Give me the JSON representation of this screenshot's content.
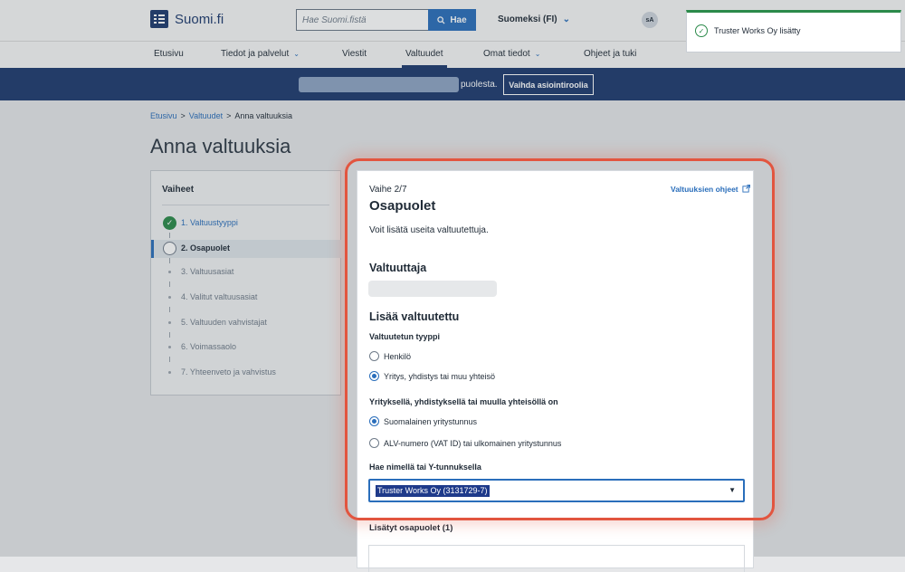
{
  "header": {
    "logo_text": "Suomi.fi",
    "search_placeholder": "Hae Suomi.fistä",
    "search_button": "Hae",
    "language": "Suomeksi (FI)",
    "user_initials": "sA"
  },
  "nav": {
    "items": [
      {
        "label": "Etusivu"
      },
      {
        "label": "Tiedot ja palvelut"
      },
      {
        "label": "Viestit"
      },
      {
        "label": "Valtuudet"
      },
      {
        "label": "Omat tiedot"
      },
      {
        "label": "Ohjeet ja tuki"
      }
    ],
    "active": "Valtuudet"
  },
  "banner": {
    "suffix_text": "puolesta.",
    "switch_button": "Vaihda asiointiroolia"
  },
  "breadcrumb": {
    "items": [
      "Etusivu",
      "Valtuudet",
      "Anna valtuuksia"
    ]
  },
  "page_title": "Anna valtuuksia",
  "steps": {
    "title": "Vaiheet",
    "items": [
      {
        "label": "1. Valtuustyyppi",
        "state": "done"
      },
      {
        "label": "2. Osapuolet",
        "state": "active"
      },
      {
        "label": "3. Valtuusasiat",
        "state": "todo"
      },
      {
        "label": "4. Valitut valtuusasiat",
        "state": "todo"
      },
      {
        "label": "5. Valtuuden vahvistajat",
        "state": "todo"
      },
      {
        "label": "6. Voimassaolo",
        "state": "todo"
      },
      {
        "label": "7. Yhteenveto ja vahvistus",
        "state": "todo"
      }
    ]
  },
  "panel": {
    "step_indicator": "Vaihe 2/7",
    "help_link": "Valtuuksien ohjeet",
    "title": "Osapuolet",
    "intro": "Voit lisätä useita valtuutettuja.",
    "grantor_heading": "Valtuuttaja",
    "add_heading": "Lisää valtuutettu",
    "type_label": "Valtuutetun tyyppi",
    "type_options": [
      "Henkilö",
      "Yritys, yhdistys tai muu yhteisö"
    ],
    "type_selected": 1,
    "id_label": "Yrityksellä, yhdistyksellä tai muulla yhteisöllä on",
    "id_options": [
      "Suomalainen yritystunnus",
      "ALV-numero (VAT ID) tai ulkomainen yritystunnus"
    ],
    "id_selected": 0,
    "search_label": "Hae nimellä tai Y-tunnuksella",
    "search_value": "Truster Works Oy (3131729-7)",
    "added_heading": "Lisätyt osapuolet (1)"
  },
  "toast": {
    "message": "Truster Works Oy lisätty",
    "color": "#2b8a4a"
  },
  "colors": {
    "brand": "#1e3a6e",
    "accent": "#2a6ebb",
    "highlight": "#e2553f"
  }
}
